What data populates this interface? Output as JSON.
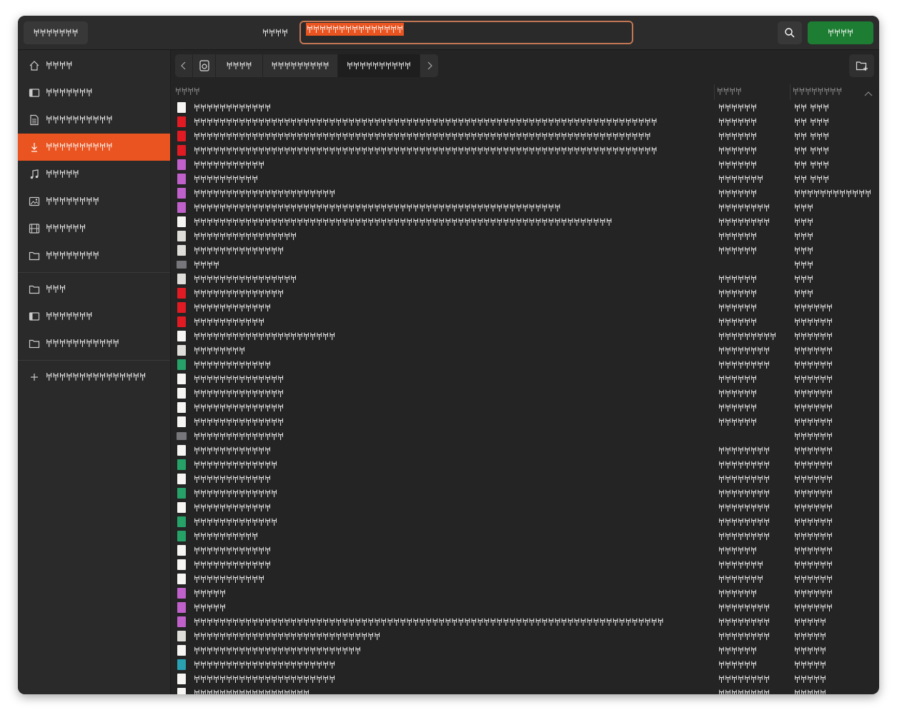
{
  "header": {
    "cancel_label": "𐀀𐀀𐀀𐀀𐀀𐀀𐀀",
    "name_label": "𐀀𐀀𐀀𐀀",
    "search_value": "𐀀𐀀𐀀𐀀𐀀𐀀𐀀𐀀𐀀𐀀𐀀𐀀𐀀𐀀𐀀",
    "open_label": "𐀀𐀀𐀀𐀀",
    "search_icon": "search-icon"
  },
  "sidebar": {
    "items": [
      {
        "label": "𐀀𐀀𐀀𐀀",
        "icon": "home-icon"
      },
      {
        "label": "𐀀𐀀𐀀𐀀𐀀𐀀𐀀",
        "icon": "desktop-icon"
      },
      {
        "label": "𐀀𐀀𐀀𐀀𐀀𐀀𐀀𐀀𐀀𐀀",
        "icon": "documents-icon"
      },
      {
        "label": "𐀀𐀀𐀀𐀀𐀀𐀀𐀀𐀀𐀀𐀀",
        "icon": "downloads-icon"
      },
      {
        "label": "𐀀𐀀𐀀𐀀𐀀",
        "icon": "music-icon"
      },
      {
        "label": "𐀀𐀀𐀀𐀀𐀀𐀀𐀀𐀀",
        "icon": "pictures-icon"
      },
      {
        "label": "𐀀𐀀𐀀𐀀𐀀𐀀",
        "icon": "videos-icon"
      },
      {
        "label": "𐀀𐀀𐀀𐀀𐀀𐀀𐀀𐀀",
        "icon": "folder-icon"
      },
      {
        "label": "𐀀𐀀𐀀",
        "icon": "folder-icon"
      },
      {
        "label": "𐀀𐀀𐀀𐀀𐀀𐀀𐀀",
        "icon": "drive-icon"
      },
      {
        "label": "𐀀𐀀𐀀𐀀𐀀𐀀𐀀𐀀𐀀𐀀𐀀",
        "icon": "folder-icon"
      },
      {
        "label": "𐀀𐀀𐀀𐀀𐀀𐀀𐀀𐀀𐀀𐀀𐀀𐀀𐀀𐀀𐀀",
        "icon": "plus-icon"
      }
    ],
    "active_index": 3
  },
  "pathbar": {
    "items": [
      "𐀀𐀀𐀀𐀀",
      "𐀀𐀀𐀀𐀀𐀀𐀀𐀀𐀀𐀀",
      "𐀀𐀀𐀀𐀀𐀀𐀀𐀀𐀀𐀀𐀀"
    ],
    "active_index": 2
  },
  "columns": {
    "name": "𐀀𐀀𐀀𐀀",
    "size": "𐀀𐀀𐀀𐀀",
    "modified": "𐀀𐀀𐀀𐀀𐀀𐀀𐀀𐀀"
  },
  "colors": {
    "accent": "#e95420",
    "open_button": "#1d7e33",
    "pdf": "#e01b24",
    "image": "#c061cb",
    "text": "#f6f5f4",
    "binary": "#deddda",
    "folder": "#77767b",
    "spreadsheet": "#26a269",
    "archive": "#2aa1b3"
  },
  "files": [
    {
      "name": "𐀀𐀀𐀀𐀀𐀀𐀀𐀀𐀀𐀀𐀀𐀀𐀀",
      "size": "𐀀𐀀𐀀𐀀𐀀𐀀",
      "date": "𐀀𐀀 𐀀𐀀𐀀",
      "type": "text"
    },
    {
      "name": "𐀀𐀀𐀀𐀀𐀀𐀀𐀀𐀀𐀀𐀀𐀀𐀀𐀀𐀀𐀀𐀀𐀀𐀀𐀀𐀀𐀀𐀀𐀀𐀀𐀀𐀀𐀀𐀀𐀀𐀀𐀀𐀀𐀀𐀀𐀀𐀀𐀀𐀀𐀀𐀀𐀀𐀀𐀀𐀀𐀀𐀀𐀀𐀀𐀀𐀀𐀀𐀀𐀀𐀀𐀀𐀀𐀀𐀀𐀀𐀀𐀀𐀀𐀀𐀀𐀀𐀀𐀀𐀀𐀀𐀀𐀀𐀀",
      "size": "𐀀𐀀𐀀𐀀𐀀𐀀",
      "date": "𐀀𐀀 𐀀𐀀𐀀",
      "type": "pdf"
    },
    {
      "name": "𐀀𐀀𐀀𐀀𐀀𐀀𐀀𐀀𐀀𐀀𐀀𐀀𐀀𐀀𐀀𐀀𐀀𐀀𐀀𐀀𐀀𐀀𐀀𐀀𐀀𐀀𐀀𐀀𐀀𐀀𐀀𐀀𐀀𐀀𐀀𐀀𐀀𐀀𐀀𐀀𐀀𐀀𐀀𐀀𐀀𐀀𐀀𐀀𐀀𐀀𐀀𐀀𐀀𐀀𐀀𐀀𐀀𐀀𐀀𐀀𐀀𐀀𐀀𐀀𐀀𐀀𐀀𐀀𐀀𐀀𐀀",
      "size": "𐀀𐀀𐀀𐀀𐀀𐀀",
      "date": "𐀀𐀀 𐀀𐀀𐀀",
      "type": "pdf"
    },
    {
      "name": "𐀀𐀀𐀀𐀀𐀀𐀀𐀀𐀀𐀀𐀀𐀀𐀀𐀀𐀀𐀀𐀀𐀀𐀀𐀀𐀀𐀀𐀀𐀀𐀀𐀀𐀀𐀀𐀀𐀀𐀀𐀀𐀀𐀀𐀀𐀀𐀀𐀀𐀀𐀀𐀀𐀀𐀀𐀀𐀀𐀀𐀀𐀀𐀀𐀀𐀀𐀀𐀀𐀀𐀀𐀀𐀀𐀀𐀀𐀀𐀀𐀀𐀀𐀀𐀀𐀀𐀀𐀀𐀀𐀀𐀀𐀀𐀀",
      "size": "𐀀𐀀𐀀𐀀𐀀𐀀",
      "date": "𐀀𐀀 𐀀𐀀𐀀",
      "type": "pdf"
    },
    {
      "name": "𐀀𐀀𐀀𐀀𐀀𐀀𐀀𐀀𐀀𐀀𐀀",
      "size": "𐀀𐀀𐀀𐀀𐀀𐀀",
      "date": "𐀀𐀀 𐀀𐀀𐀀",
      "type": "image"
    },
    {
      "name": "𐀀𐀀𐀀𐀀𐀀𐀀𐀀𐀀𐀀𐀀",
      "size": "𐀀𐀀𐀀𐀀𐀀𐀀𐀀",
      "date": "𐀀𐀀 𐀀𐀀𐀀",
      "type": "image"
    },
    {
      "name": "𐀀𐀀𐀀𐀀𐀀𐀀𐀀𐀀𐀀𐀀𐀀𐀀𐀀𐀀𐀀𐀀𐀀𐀀𐀀𐀀𐀀𐀀",
      "size": "𐀀𐀀𐀀𐀀𐀀𐀀",
      "date": "𐀀𐀀𐀀𐀀𐀀𐀀𐀀𐀀𐀀𐀀𐀀𐀀",
      "type": "image"
    },
    {
      "name": "𐀀𐀀𐀀𐀀𐀀𐀀𐀀𐀀𐀀𐀀𐀀𐀀𐀀𐀀𐀀𐀀𐀀𐀀𐀀𐀀𐀀𐀀𐀀𐀀𐀀𐀀𐀀𐀀𐀀𐀀𐀀𐀀𐀀𐀀𐀀𐀀𐀀𐀀𐀀𐀀𐀀𐀀𐀀𐀀𐀀𐀀𐀀𐀀𐀀𐀀𐀀𐀀𐀀𐀀𐀀𐀀𐀀",
      "size": "𐀀𐀀𐀀𐀀𐀀𐀀𐀀𐀀",
      "date": "𐀀𐀀𐀀",
      "type": "image"
    },
    {
      "name": "𐀀𐀀𐀀𐀀𐀀𐀀𐀀𐀀𐀀𐀀𐀀𐀀𐀀𐀀𐀀𐀀𐀀𐀀𐀀𐀀𐀀𐀀𐀀𐀀𐀀𐀀𐀀𐀀𐀀𐀀𐀀𐀀𐀀𐀀𐀀𐀀𐀀𐀀𐀀𐀀𐀀𐀀𐀀𐀀𐀀𐀀𐀀𐀀𐀀𐀀𐀀𐀀𐀀𐀀𐀀𐀀𐀀𐀀𐀀𐀀𐀀𐀀𐀀𐀀𐀀",
      "size": "𐀀𐀀𐀀𐀀𐀀𐀀𐀀𐀀",
      "date": "𐀀𐀀𐀀",
      "type": "text"
    },
    {
      "name": "𐀀𐀀𐀀𐀀𐀀𐀀𐀀𐀀𐀀𐀀𐀀𐀀𐀀𐀀𐀀𐀀",
      "size": "𐀀𐀀𐀀𐀀𐀀𐀀",
      "date": "𐀀𐀀𐀀",
      "type": "binary"
    },
    {
      "name": "𐀀𐀀𐀀𐀀𐀀𐀀𐀀𐀀𐀀𐀀𐀀𐀀𐀀𐀀",
      "size": "𐀀𐀀𐀀𐀀𐀀𐀀",
      "date": "𐀀𐀀𐀀",
      "type": "binary"
    },
    {
      "name": "𐀀𐀀𐀀𐀀",
      "size": "",
      "date": "𐀀𐀀𐀀",
      "type": "folder"
    },
    {
      "name": "𐀀𐀀𐀀𐀀𐀀𐀀𐀀𐀀𐀀𐀀𐀀𐀀𐀀𐀀𐀀𐀀",
      "size": "𐀀𐀀𐀀𐀀𐀀𐀀",
      "date": "𐀀𐀀𐀀",
      "type": "binary"
    },
    {
      "name": "𐀀𐀀𐀀𐀀𐀀𐀀𐀀𐀀𐀀𐀀𐀀𐀀𐀀𐀀",
      "size": "𐀀𐀀𐀀𐀀𐀀𐀀",
      "date": "𐀀𐀀𐀀",
      "type": "pdf"
    },
    {
      "name": "𐀀𐀀𐀀𐀀𐀀𐀀𐀀𐀀𐀀𐀀𐀀𐀀",
      "size": "𐀀𐀀𐀀𐀀𐀀𐀀",
      "date": "𐀀𐀀𐀀𐀀𐀀𐀀",
      "type": "pdf"
    },
    {
      "name": "𐀀𐀀𐀀𐀀𐀀𐀀𐀀𐀀𐀀𐀀𐀀",
      "size": "𐀀𐀀𐀀𐀀𐀀𐀀",
      "date": "𐀀𐀀𐀀𐀀𐀀𐀀",
      "type": "pdf"
    },
    {
      "name": "𐀀𐀀𐀀𐀀𐀀𐀀𐀀𐀀𐀀𐀀𐀀𐀀𐀀𐀀𐀀𐀀𐀀𐀀𐀀𐀀𐀀𐀀",
      "size": "𐀀𐀀𐀀𐀀𐀀𐀀𐀀𐀀𐀀",
      "date": "𐀀𐀀𐀀𐀀𐀀𐀀",
      "type": "text"
    },
    {
      "name": "𐀀𐀀𐀀𐀀𐀀𐀀𐀀𐀀",
      "size": "𐀀𐀀𐀀𐀀𐀀𐀀𐀀𐀀",
      "date": "𐀀𐀀𐀀𐀀𐀀𐀀",
      "type": "binary"
    },
    {
      "name": "𐀀𐀀𐀀𐀀𐀀𐀀𐀀𐀀𐀀𐀀𐀀𐀀",
      "size": "𐀀𐀀𐀀𐀀𐀀𐀀𐀀𐀀",
      "date": "𐀀𐀀𐀀𐀀𐀀𐀀",
      "type": "spreadsheet"
    },
    {
      "name": "𐀀𐀀𐀀𐀀𐀀𐀀𐀀𐀀𐀀𐀀𐀀𐀀𐀀𐀀",
      "size": "𐀀𐀀𐀀𐀀𐀀𐀀",
      "date": "𐀀𐀀𐀀𐀀𐀀𐀀",
      "type": "text"
    },
    {
      "name": "𐀀𐀀𐀀𐀀𐀀𐀀𐀀𐀀𐀀𐀀𐀀𐀀𐀀𐀀",
      "size": "𐀀𐀀𐀀𐀀𐀀𐀀",
      "date": "𐀀𐀀𐀀𐀀𐀀𐀀",
      "type": "text"
    },
    {
      "name": "𐀀𐀀𐀀𐀀𐀀𐀀𐀀𐀀𐀀𐀀𐀀𐀀𐀀𐀀",
      "size": "𐀀𐀀𐀀𐀀𐀀𐀀",
      "date": "𐀀𐀀𐀀𐀀𐀀𐀀",
      "type": "text"
    },
    {
      "name": "𐀀𐀀𐀀𐀀𐀀𐀀𐀀𐀀𐀀𐀀𐀀𐀀𐀀𐀀",
      "size": "𐀀𐀀𐀀𐀀𐀀𐀀",
      "date": "𐀀𐀀𐀀𐀀𐀀𐀀",
      "type": "text"
    },
    {
      "name": "𐀀𐀀𐀀𐀀𐀀𐀀𐀀𐀀𐀀𐀀𐀀𐀀𐀀𐀀",
      "size": "",
      "date": "𐀀𐀀𐀀𐀀𐀀𐀀",
      "type": "folder"
    },
    {
      "name": "𐀀𐀀𐀀𐀀𐀀𐀀𐀀𐀀𐀀𐀀𐀀𐀀",
      "size": "𐀀𐀀𐀀𐀀𐀀𐀀𐀀𐀀",
      "date": "𐀀𐀀𐀀𐀀𐀀𐀀",
      "type": "text"
    },
    {
      "name": "𐀀𐀀𐀀𐀀𐀀𐀀𐀀𐀀𐀀𐀀𐀀𐀀𐀀",
      "size": "𐀀𐀀𐀀𐀀𐀀𐀀𐀀𐀀",
      "date": "𐀀𐀀𐀀𐀀𐀀𐀀",
      "type": "spreadsheet"
    },
    {
      "name": "𐀀𐀀𐀀𐀀𐀀𐀀𐀀𐀀𐀀𐀀𐀀𐀀",
      "size": "𐀀𐀀𐀀𐀀𐀀𐀀𐀀𐀀",
      "date": "𐀀𐀀𐀀𐀀𐀀𐀀",
      "type": "text"
    },
    {
      "name": "𐀀𐀀𐀀𐀀𐀀𐀀𐀀𐀀𐀀𐀀𐀀𐀀𐀀",
      "size": "𐀀𐀀𐀀𐀀𐀀𐀀𐀀𐀀",
      "date": "𐀀𐀀𐀀𐀀𐀀𐀀",
      "type": "spreadsheet"
    },
    {
      "name": "𐀀𐀀𐀀𐀀𐀀𐀀𐀀𐀀𐀀𐀀𐀀𐀀",
      "size": "𐀀𐀀𐀀𐀀𐀀𐀀𐀀𐀀",
      "date": "𐀀𐀀𐀀𐀀𐀀𐀀",
      "type": "text"
    },
    {
      "name": "𐀀𐀀𐀀𐀀𐀀𐀀𐀀𐀀𐀀𐀀𐀀𐀀𐀀",
      "size": "𐀀𐀀𐀀𐀀𐀀𐀀𐀀𐀀",
      "date": "𐀀𐀀𐀀𐀀𐀀𐀀",
      "type": "spreadsheet"
    },
    {
      "name": "𐀀𐀀𐀀𐀀𐀀𐀀𐀀𐀀𐀀𐀀",
      "size": "𐀀𐀀𐀀𐀀𐀀𐀀𐀀𐀀",
      "date": "𐀀𐀀𐀀𐀀𐀀𐀀",
      "type": "spreadsheet"
    },
    {
      "name": "𐀀𐀀𐀀𐀀𐀀𐀀𐀀𐀀𐀀𐀀𐀀𐀀",
      "size": "𐀀𐀀𐀀𐀀𐀀𐀀",
      "date": "𐀀𐀀𐀀𐀀𐀀𐀀",
      "type": "text"
    },
    {
      "name": "𐀀𐀀𐀀𐀀𐀀𐀀𐀀𐀀𐀀𐀀𐀀𐀀",
      "size": "𐀀𐀀𐀀𐀀𐀀𐀀𐀀",
      "date": "𐀀𐀀𐀀𐀀𐀀𐀀",
      "type": "text"
    },
    {
      "name": "𐀀𐀀𐀀𐀀𐀀𐀀𐀀𐀀𐀀𐀀𐀀",
      "size": "𐀀𐀀𐀀𐀀𐀀𐀀𐀀",
      "date": "𐀀𐀀𐀀𐀀𐀀𐀀",
      "type": "text"
    },
    {
      "name": "𐀀𐀀𐀀𐀀𐀀",
      "size": "𐀀𐀀𐀀𐀀𐀀𐀀",
      "date": "𐀀𐀀𐀀𐀀𐀀𐀀",
      "type": "image"
    },
    {
      "name": "𐀀𐀀𐀀𐀀𐀀",
      "size": "𐀀𐀀𐀀𐀀𐀀𐀀𐀀𐀀",
      "date": "𐀀𐀀𐀀𐀀𐀀𐀀",
      "type": "image"
    },
    {
      "name": "𐀀𐀀𐀀𐀀𐀀𐀀𐀀𐀀𐀀𐀀𐀀𐀀𐀀𐀀𐀀𐀀𐀀𐀀𐀀𐀀𐀀𐀀𐀀𐀀𐀀𐀀𐀀𐀀𐀀𐀀𐀀𐀀𐀀𐀀𐀀𐀀𐀀𐀀𐀀𐀀𐀀𐀀𐀀𐀀𐀀𐀀𐀀𐀀𐀀𐀀𐀀𐀀𐀀𐀀𐀀𐀀𐀀𐀀𐀀𐀀𐀀𐀀𐀀𐀀𐀀𐀀𐀀𐀀𐀀𐀀𐀀𐀀𐀀",
      "size": "𐀀𐀀𐀀𐀀𐀀𐀀𐀀𐀀",
      "date": "𐀀𐀀𐀀𐀀𐀀",
      "type": "image"
    },
    {
      "name": "𐀀𐀀𐀀𐀀𐀀𐀀𐀀𐀀𐀀𐀀𐀀𐀀𐀀𐀀𐀀𐀀𐀀𐀀𐀀𐀀𐀀𐀀𐀀𐀀𐀀𐀀𐀀𐀀𐀀",
      "size": "𐀀𐀀𐀀𐀀𐀀𐀀𐀀𐀀",
      "date": "𐀀𐀀𐀀𐀀𐀀",
      "type": "binary"
    },
    {
      "name": "𐀀𐀀𐀀𐀀𐀀𐀀𐀀𐀀𐀀𐀀𐀀𐀀𐀀𐀀𐀀𐀀𐀀𐀀𐀀𐀀𐀀𐀀𐀀𐀀𐀀𐀀",
      "size": "𐀀𐀀𐀀𐀀𐀀𐀀",
      "date": "𐀀𐀀𐀀𐀀𐀀",
      "type": "text"
    },
    {
      "name": "𐀀𐀀𐀀𐀀𐀀𐀀𐀀𐀀𐀀𐀀𐀀𐀀𐀀𐀀𐀀𐀀𐀀𐀀𐀀𐀀𐀀𐀀",
      "size": "𐀀𐀀𐀀𐀀𐀀𐀀",
      "date": "𐀀𐀀𐀀𐀀𐀀",
      "type": "archive"
    },
    {
      "name": "𐀀𐀀𐀀𐀀𐀀𐀀𐀀𐀀𐀀𐀀𐀀𐀀𐀀𐀀𐀀𐀀𐀀𐀀𐀀𐀀𐀀𐀀",
      "size": "𐀀𐀀𐀀𐀀𐀀𐀀𐀀𐀀",
      "date": "𐀀𐀀𐀀𐀀𐀀",
      "type": "text"
    },
    {
      "name": "𐀀𐀀𐀀𐀀𐀀𐀀𐀀𐀀𐀀𐀀𐀀𐀀𐀀𐀀𐀀𐀀𐀀𐀀",
      "size": "𐀀𐀀𐀀𐀀𐀀𐀀𐀀𐀀",
      "date": "𐀀𐀀𐀀𐀀𐀀",
      "type": "text"
    }
  ]
}
